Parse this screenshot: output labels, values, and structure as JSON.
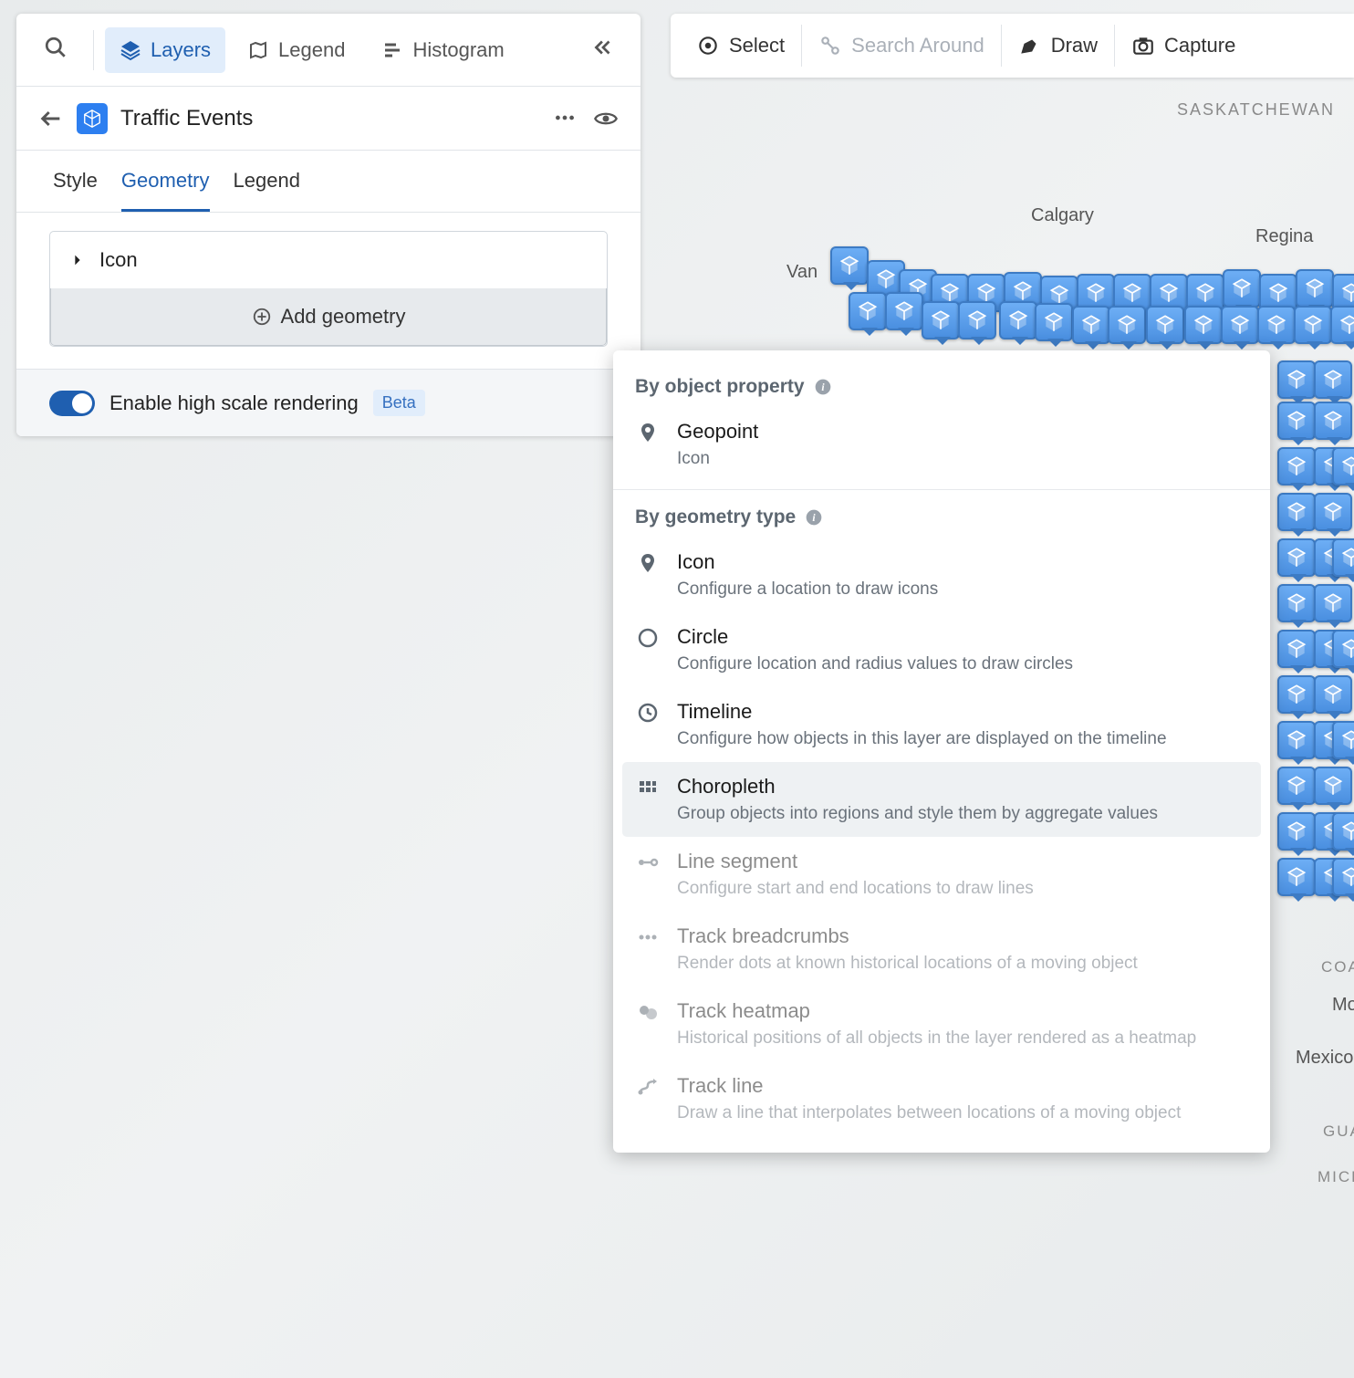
{
  "toolbar": {
    "select": "Select",
    "search_around": "Search Around",
    "draw": "Draw",
    "capture": "Capture"
  },
  "sidebar": {
    "tabs": {
      "layers": "Layers",
      "legend": "Legend",
      "histogram": "Histogram"
    }
  },
  "layer": {
    "title": "Traffic Events",
    "subtabs": {
      "style": "Style",
      "geometry": "Geometry",
      "legend": "Legend"
    },
    "icon_section": "Icon",
    "add_geometry": "Add geometry",
    "footer_label": "Enable high scale rendering",
    "beta_badge": "Beta"
  },
  "popover": {
    "section1": "By object property",
    "section2": "By geometry type",
    "items": {
      "geopoint": {
        "title": "Geopoint",
        "desc": "Icon"
      },
      "icon": {
        "title": "Icon",
        "desc": "Configure a location to draw icons"
      },
      "circle": {
        "title": "Circle",
        "desc": "Configure location and radius values to draw circles"
      },
      "timeline": {
        "title": "Timeline",
        "desc": "Configure how objects in this layer are displayed on the timeline"
      },
      "choropleth": {
        "title": "Choropleth",
        "desc": "Group objects into regions and style them by aggregate values"
      },
      "line_segment": {
        "title": "Line segment",
        "desc": "Configure start and end locations to draw lines"
      },
      "track_breadcrumbs": {
        "title": "Track breadcrumbs",
        "desc": "Render dots at known historical locations of a moving object"
      },
      "track_heatmap": {
        "title": "Track heatmap",
        "desc": "Historical positions of all objects in the layer rendered as a heatmap"
      },
      "track_line": {
        "title": "Track line",
        "desc": "Draw a line that interpolates between locations of a moving object"
      }
    }
  },
  "map": {
    "labels": {
      "saskatchewan": "SASKATCHEWAN",
      "calgary": "Calgary",
      "regina": "Regina",
      "vancouver": "Van",
      "coa": "COA.",
      "mo": "Mo",
      "mexico": "Mexico",
      "gua": "GUA.",
      "mich": "MICH."
    }
  }
}
